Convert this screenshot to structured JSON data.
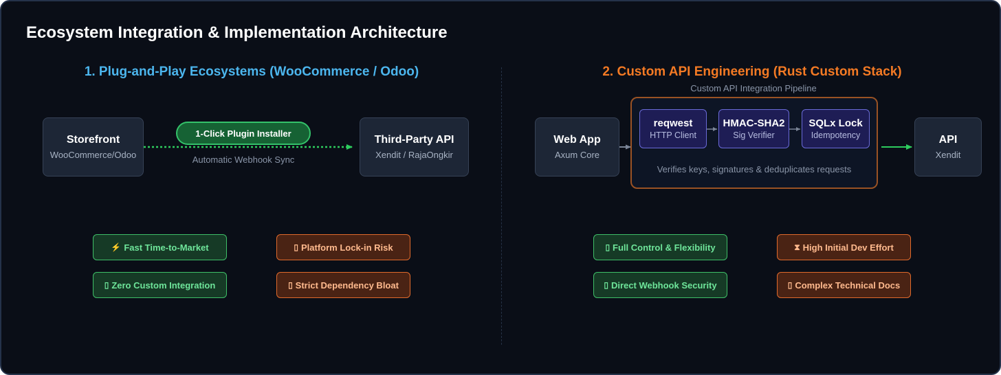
{
  "title": "Ecosystem Integration & Implementation Architecture",
  "colors": {
    "left_heading": "#4cb6ee",
    "right_heading": "#f47a24",
    "pro": "#3fbf68",
    "con": "#e06a2c",
    "green_arrow": "#2ecc5e"
  },
  "left": {
    "heading": "1. Plug-and-Play Ecosystems (WooCommerce / Odoo)",
    "storefront": {
      "title": "Storefront",
      "sub": "WooCommerce/Odoo"
    },
    "installer_label": "1-Click Plugin Installer",
    "sync_caption": "Automatic Webhook Sync",
    "third_party": {
      "title": "Third-Party API",
      "sub": "Xendit / RajaOngkir"
    },
    "badges": [
      {
        "icon": "⚡",
        "icon_name": "lightning-icon",
        "label": "Fast Time-to-Market",
        "kind": "pro"
      },
      {
        "icon": "▯",
        "icon_name": "missing-glyph-icon",
        "label": "Platform Lock-in Risk",
        "kind": "con"
      },
      {
        "icon": "▯",
        "icon_name": "missing-glyph-icon",
        "label": "Zero Custom Integration",
        "kind": "pro"
      },
      {
        "icon": "▯",
        "icon_name": "missing-glyph-icon",
        "label": "Strict Dependency Bloat",
        "kind": "con"
      }
    ]
  },
  "right": {
    "heading": "2. Custom API Engineering (Rust Custom Stack)",
    "web_app": {
      "title": "Web App",
      "sub": "Axum Core"
    },
    "pipeline_label": "Custom API Integration Pipeline",
    "steps": [
      {
        "title": "reqwest",
        "sub": "HTTP Client"
      },
      {
        "title": "HMAC-SHA2",
        "sub": "Sig Verifier"
      },
      {
        "title": "SQLx Lock",
        "sub": "Idempotency"
      }
    ],
    "pipeline_caption": "Verifies keys, signatures & deduplicates requests",
    "api": {
      "title": "API",
      "sub": "Xendit"
    },
    "badges": [
      {
        "icon": "▯",
        "icon_name": "missing-glyph-icon",
        "label": "Full Control & Flexibility",
        "kind": "pro"
      },
      {
        "icon": "⧗",
        "icon_name": "hourglass-icon",
        "label": "High Initial Dev Effort",
        "kind": "con"
      },
      {
        "icon": "▯",
        "icon_name": "missing-glyph-icon",
        "label": "Direct Webhook Security",
        "kind": "pro"
      },
      {
        "icon": "▯",
        "icon_name": "missing-glyph-icon",
        "label": "Complex Technical Docs",
        "kind": "con"
      }
    ]
  }
}
